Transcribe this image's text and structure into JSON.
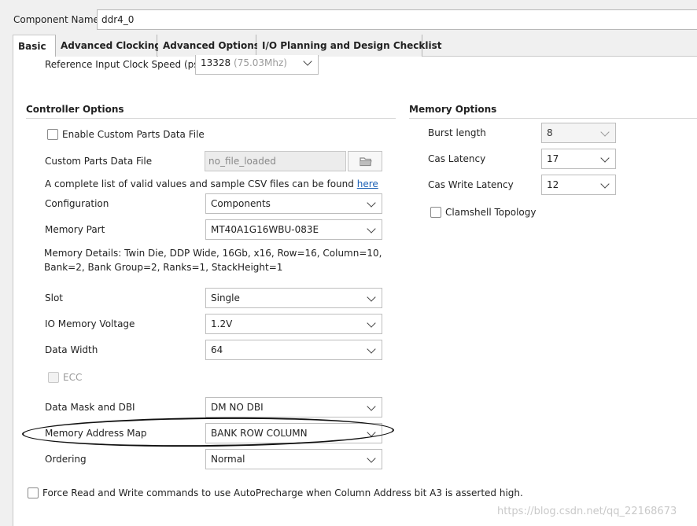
{
  "header": {
    "component_name_label": "Component Name",
    "component_name_value": "ddr4_0"
  },
  "tabs": [
    {
      "label": "Basic"
    },
    {
      "label": "Advanced Clocking"
    },
    {
      "label": "Advanced Options"
    },
    {
      "label": "I/O Planning and Design Checklist"
    }
  ],
  "top": {
    "ref_clock_label": "Reference Input Clock Speed (ps)",
    "ref_clock_value": "13328",
    "ref_clock_hint": "(75.03Mhz)"
  },
  "controller": {
    "title": "Controller Options",
    "enable_custom_label": "Enable Custom Parts Data File",
    "custom_file_label": "Custom Parts Data File",
    "custom_file_value": "no_file_loaded",
    "csv_note": "A complete list of valid values and sample CSV files can be found",
    "csv_link": "here",
    "configuration_label": "Configuration",
    "configuration_value": "Components",
    "memory_part_label": "Memory Part",
    "memory_part_value": "MT40A1G16WBU-083E",
    "memory_details_line1": "Memory Details: Twin Die, DDP Wide, 16Gb, x16, Row=16, Column=10,",
    "memory_details_line2": "Bank=2, Bank Group=2, Ranks=1, StackHeight=1",
    "slot_label": "Slot",
    "slot_value": "Single",
    "io_voltage_label": "IO Memory Voltage",
    "io_voltage_value": "1.2V",
    "data_width_label": "Data Width",
    "data_width_value": "64",
    "ecc_label": "ECC",
    "data_mask_label": "Data Mask and DBI",
    "data_mask_value": "DM NO DBI",
    "address_map_label": "Memory Address Map",
    "address_map_value": "BANK ROW COLUMN",
    "ordering_label": "Ordering",
    "ordering_value": "Normal"
  },
  "memory": {
    "title": "Memory Options",
    "burst_label": "Burst length",
    "burst_value": "8",
    "cas_label": "Cas Latency",
    "cas_value": "17",
    "cas_write_label": "Cas Write Latency",
    "cas_write_value": "12",
    "clamshell_label": "Clamshell Topology"
  },
  "force_label": "Force Read and Write commands to use AutoPrecharge when Column Address bit A3 is asserted high.",
  "watermark": "https://blog.csdn.net/qq_22168673"
}
